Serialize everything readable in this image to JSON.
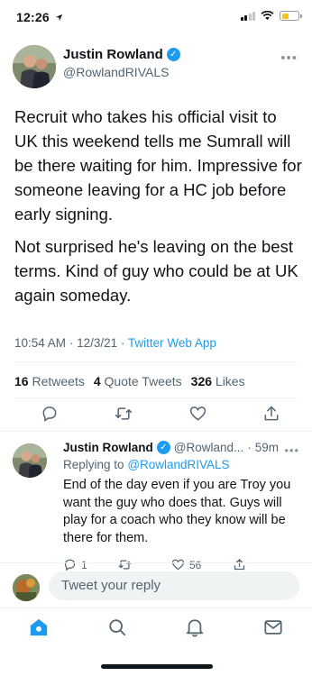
{
  "status_bar": {
    "time": "12:26"
  },
  "tweet": {
    "author_name": "Justin Rowland",
    "handle": "@RowlandRIVALS",
    "paragraphs": [
      "Recruit who takes his official visit to UK this weekend tells me Sumrall will be there waiting for him. Impressive for someone leaving for a HC job before early signing.",
      "Not surprised he's leaving on the best terms. Kind of guy who could be at UK again someday."
    ],
    "time": "10:54 AM",
    "date": "12/3/21",
    "app": "Twitter Web App",
    "stats": {
      "retweets_count": "16",
      "retweets_label": "Retweets",
      "quotes_count": "4",
      "quotes_label": "Quote Tweets",
      "likes_count": "326",
      "likes_label": "Likes"
    }
  },
  "reply": {
    "author_name": "Justin Rowland",
    "handle": "@Rowland...",
    "time": "59m",
    "replying_prefix": "Replying to",
    "replying_handle": "@RowlandRIVALS",
    "text": "End of the day even if you are Troy you want the guy who does that.  Guys will play for a coach who they know will be there for them.",
    "reply_count": "1",
    "like_count": "56"
  },
  "compose": {
    "placeholder": "Tweet your reply"
  },
  "colors": {
    "accent": "#1d9bf0",
    "text": "#0f1419",
    "secondary": "#536471"
  },
  "nav": {
    "active": "home"
  }
}
